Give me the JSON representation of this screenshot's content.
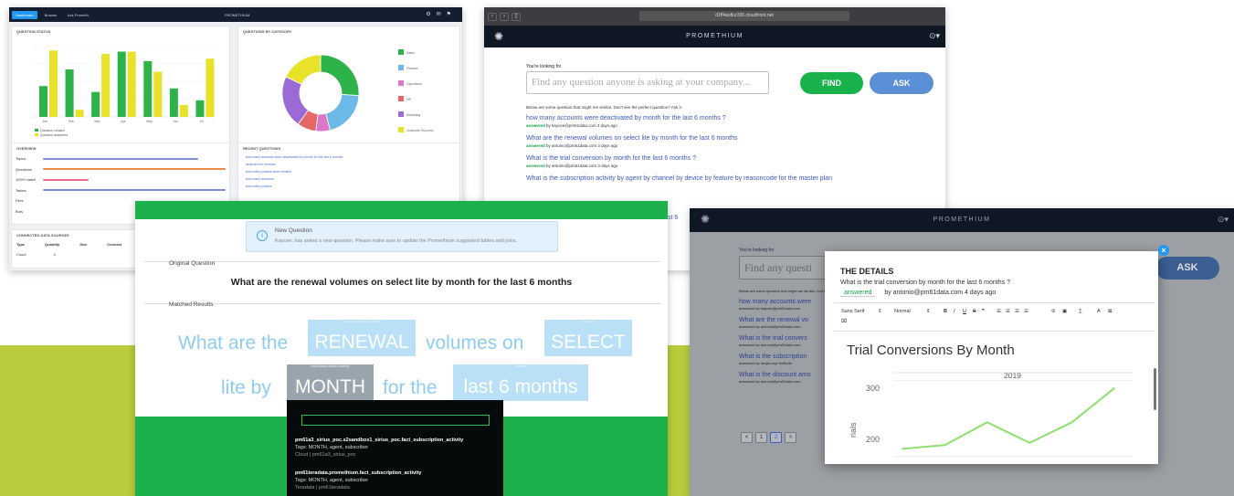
{
  "dashboard": {
    "tabs": [
      "Dashboard",
      "Browse",
      "Ask Prometh."
    ],
    "title": "PROMETHIUM",
    "question_stats_title": "QUESTION STATUS",
    "donut_title": "QUESTIONS BY CATEGORY",
    "overview_title": "OVERVIEW",
    "recent_title": "RECENT QUESTIONS",
    "connected_title": "CONNECTED DATA SOURCES",
    "bar_legend": [
      "Question created",
      "Question answered"
    ],
    "bar_categories": [
      "Jan",
      "Feb",
      "Mar",
      "Apr",
      "May",
      "Jun",
      "Jul"
    ],
    "bar_colors": {
      "green": "#2db34a",
      "yellow": "#e9e22a"
    },
    "stats": [
      "Topics",
      "Questions",
      "100% match",
      "Tables",
      "Files",
      "Bots"
    ],
    "stat_bar_colors": [
      "#7b8ddb",
      "#e98a4f",
      "#e86b8b",
      "#7b8ddb",
      "#e98a4f",
      "#7b8ddb"
    ],
    "recent_lines": [
      "how many accounts were deactivated by month for the last 6 months",
      "what are the renewal",
      "how many policies were created",
      "how many accounts",
      "how many policies"
    ],
    "connected_headers": [
      "Type",
      "Quantity",
      "Size",
      "Connect"
    ],
    "connected_rows": [
      [
        "Cloud",
        "4",
        "",
        ""
      ]
    ]
  },
  "search_window": {
    "url": "d1ff4ax8ur336.cloudfront.net",
    "brand": "PROMETHIUM",
    "looking_for": "You're looking for",
    "placeholder": "Find any question anyone is asking at your company...",
    "find": "FIND",
    "ask": "ASK",
    "intro": "Below are some question that might me similar. Don't see the perfect question? Ask it.",
    "questions": [
      {
        "q": "how many accounts were deactivated by month for the last 6 months ?",
        "status": "answered",
        "meta": "by kaycee@pm61data.com 3 days ago"
      },
      {
        "q": "What are the renewal volumes on select lite by month for the last 6 months",
        "status": "answered",
        "meta": "by antonio@pm61data.com 3 days ago"
      },
      {
        "q": "What is the trial conversion by month for the last 6 months ?",
        "status": "answered",
        "meta": "by antonio@pm61data.com 3 days ago"
      },
      {
        "q": "What is the subscription activity by agent by channel by device by feature by reasoncode for the master plan",
        "status": "",
        "meta": ""
      }
    ],
    "overflow_text": "st 6"
  },
  "match_window": {
    "notice_title": "New Question",
    "notice_msg": "Kaycee, has asked a new question. Please make sure to update the Promethium suggested tables and joins.",
    "original_label": "Original Question",
    "original_question": "What are the renewal volumes on select lite by month for the last 6 months",
    "matched_label": "Matched Results",
    "words": {
      "w1": "What are the",
      "renewal": "RENEWAL",
      "renewal_tag": "dim.subscription activity",
      "w2": "volumes on",
      "select": "SELECT",
      "select_tag": "dim.plan",
      "w3": "lite by",
      "month": "MONTH",
      "month_tag": "fact.subscription.activity",
      "w4": "for the",
      "last": "last 6 months",
      "last_tag": "relative"
    },
    "results": [
      {
        "name": "pm61a3_sirius_poc.s2sandbox1_sirius_poc.fact_subscription_activity",
        "tags": "Tags: MONTH, agent, subscriber",
        "src": "Cloud | pm61a3_sirius_poc"
      },
      {
        "name": "pm61teradata.promethium.fact_subscription_activity",
        "tags": "Tags: MONTH, agent, subscriber",
        "src": "Teradata | pm61teradata"
      }
    ]
  },
  "details_window": {
    "brand": "PROMETHIUM",
    "looking_for": "You're looking for",
    "placeholder": "Find any questi",
    "ask": "ASK",
    "intro": "Below are some question that might me similar. Don't see the perfect question? Ask it.",
    "bg_questions": [
      {
        "q": "how many accounts were",
        "meta": "answered by kaycee@pm61data.com"
      },
      {
        "q": "What are the renewal vo",
        "meta": "answered by antonio@pm61data.com"
      },
      {
        "q": "What is the trial convers",
        "meta": "answered by antonio@pm61data.com"
      },
      {
        "q": "What is the subscription",
        "meta": "answered by ranjan.ray+buffto3c"
      },
      {
        "q": "What is the discount amo",
        "meta": "answered by antonio@pm61data.com"
      }
    ],
    "pages": [
      "<",
      "1",
      "2",
      ">"
    ],
    "current_page": "2",
    "modal": {
      "title": "THE DETAILS",
      "question": "What is the trial conversion by month for the last 6 months ?",
      "status": "answered",
      "meta": "by antonio@pm61data.com 4 days ago",
      "font": "Sans Serif",
      "size": "Normal",
      "chart_title": "Trial Conversions By Month",
      "chart_year": "2019",
      "y_label": "rials",
      "y_ticks": [
        "300",
        "200"
      ]
    }
  },
  "chart_data": [
    {
      "type": "bar",
      "categories": [
        "Jan",
        "Feb",
        "Mar",
        "Apr",
        "May",
        "Jun",
        "Jul"
      ],
      "series": [
        {
          "name": "Question created",
          "values": [
            26,
            40,
            21,
            55,
            47,
            24,
            14
          ]
        },
        {
          "name": "Question answered",
          "values": [
            56,
            6,
            53,
            55,
            38,
            10,
            49
          ]
        }
      ],
      "ylim": [
        0,
        60
      ]
    },
    {
      "type": "pie",
      "categories": [
        "Sales",
        "Finance",
        "Operations",
        "HR",
        "Marketing",
        "Customer Success"
      ],
      "values": [
        26,
        20,
        6,
        8,
        22,
        18
      ],
      "colors": [
        "#2db34a",
        "#6cb9e7",
        "#d978c8",
        "#e66767",
        "#9b6ad4",
        "#e9e22a"
      ]
    },
    {
      "type": "line",
      "title": "Trial Conversions By Month",
      "x": [
        1,
        2,
        3,
        4,
        5,
        6
      ],
      "y": [
        210,
        215,
        245,
        218,
        245,
        290
      ],
      "ylim": [
        190,
        320
      ]
    }
  ]
}
